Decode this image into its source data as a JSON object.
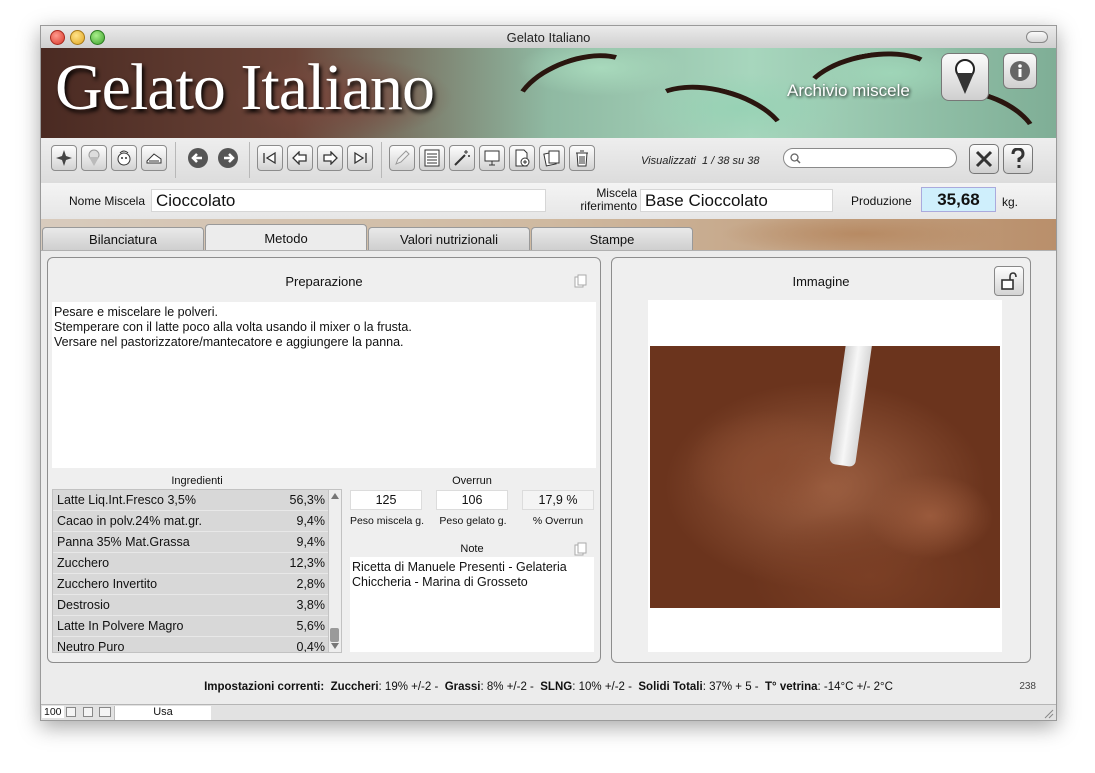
{
  "window": {
    "title": "Gelato Italiano"
  },
  "banner": {
    "title": "Gelato Italiano",
    "section": "Archivio miscele"
  },
  "toolbar": {
    "viewed_label": "Visualizzati",
    "viewed_count": "1 / 38 su 38",
    "search_placeholder": ""
  },
  "fields": {
    "name_label": "Nome Miscela",
    "name_value": "Cioccolato",
    "ref_label_1": "Miscela",
    "ref_label_2": "riferimento",
    "ref_value": "Base Cioccolato",
    "production_label": "Produzione",
    "production_value": "35,68",
    "production_unit": "kg."
  },
  "tabs": [
    {
      "label": "Bilanciatura",
      "active": false
    },
    {
      "label": "Metodo",
      "active": true
    },
    {
      "label": "Valori nutrizionali",
      "active": false
    },
    {
      "label": "Stampe",
      "active": false
    }
  ],
  "preparation": {
    "title": "Preparazione",
    "lines": [
      "Pesare e miscelare le polveri.",
      "Stemperare con il latte poco alla volta usando il mixer o la frusta.",
      "Versare nel pastorizzatore/mantecatore e aggiungere la panna."
    ]
  },
  "ingredients": {
    "title": "Ingredienti",
    "rows": [
      {
        "name": "Latte  Liq.Int.Fresco 3,5%",
        "pct": "56,3%"
      },
      {
        "name": "Cacao in polv.24% mat.gr.",
        "pct": "9,4%"
      },
      {
        "name": "Panna 35% Mat.Grassa",
        "pct": "9,4%"
      },
      {
        "name": "Zucchero",
        "pct": "12,3%"
      },
      {
        "name": "Zucchero Invertito",
        "pct": "2,8%"
      },
      {
        "name": "Destrosio",
        "pct": "3,8%"
      },
      {
        "name": "Latte In Polvere Magro",
        "pct": "5,6%"
      },
      {
        "name": "Neutro Puro",
        "pct": "0,4%"
      }
    ]
  },
  "overrun": {
    "title": "Overrun",
    "mix_weight": "125",
    "gelato_weight": "106",
    "overrun_pct": "17,9 %",
    "mix_weight_label": "Peso miscela g.",
    "gelato_weight_label": "Peso gelato g.",
    "overrun_label": "% Overrun"
  },
  "notes": {
    "title": "Note",
    "lines": [
      "Ricetta di Manuele Presenti - Gelateria",
      "Chiccheria - Marina di Grosseto"
    ]
  },
  "image_panel": {
    "title": "Immagine"
  },
  "status": {
    "prefix": "Impostazioni correnti:",
    "s1_label": "Zuccheri",
    "s1_value": ": 19% +/-2  -",
    "s2_label": "Grassi",
    "s2_value": ": 8%  +/-2  -",
    "s3_label": "SLNG",
    "s3_value": ": 10%  +/-2  -",
    "s4_label": "Solidi Totali",
    "s4_value": ": 37%  + 5 -",
    "s5_label": "T° vetrina",
    "s5_value": ": -14°C +/- 2°C",
    "record": "238"
  },
  "bottombar": {
    "zoom": "100",
    "mode": "Usa"
  }
}
